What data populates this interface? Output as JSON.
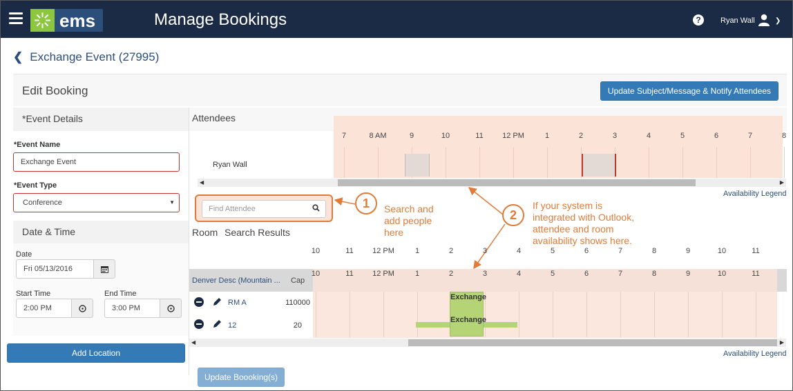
{
  "header": {
    "app_name": "ems",
    "page_title": "Manage Bookings",
    "user_name": "Ryan Wall",
    "colors": {
      "topbar": "#1c2b45",
      "brand_green": "#8dc63f",
      "primary": "#337ab7",
      "accent": "#e07b39"
    }
  },
  "event": {
    "title": "Exchange Event (27995)"
  },
  "edit_booking": {
    "title": "Edit Booking",
    "update_notify_label": "Update Subject/Message & Notify Attendees"
  },
  "event_details": {
    "section_title": "*Event Details",
    "event_name_label": "*Event Name",
    "event_name_value": "Exchange Event",
    "event_type_label": "*Event Type",
    "event_type_value": "Conference"
  },
  "date_time": {
    "section_title": "Date & Time",
    "date_label": "Date",
    "date_value": "Fri 05/13/2016",
    "start_label": "Start Time",
    "start_value": "2:00 PM",
    "end_label": "End Time",
    "end_value": "3:00 PM"
  },
  "add_location_label": "Add Location",
  "attendees": {
    "title": "Attendees",
    "hours": [
      "7",
      "8 AM",
      "9",
      "10",
      "11",
      "12 PM",
      "1",
      "2",
      "3",
      "4",
      "5",
      "6",
      "7",
      "8"
    ],
    "rows": [
      {
        "name": "Ryan Wall"
      }
    ],
    "availability_legend": "Availability Legend",
    "find_placeholder": "Find Attendee"
  },
  "callouts": [
    {
      "number": "1",
      "lines": [
        "Search and",
        "add people",
        "here"
      ]
    },
    {
      "number": "2",
      "lines": [
        "If your system is",
        "integrated with Outlook,",
        "attendee and room",
        "availability shows here."
      ]
    }
  ],
  "rooms": {
    "tabs": [
      "Room",
      "Search Results"
    ],
    "hours": [
      "10",
      "11",
      "12 PM",
      "1",
      "2",
      "3",
      "4",
      "5",
      "6",
      "7",
      "8",
      "9",
      "10",
      "11"
    ],
    "header_building": "Denver Desc (Mountain ...",
    "header_cap": "Cap",
    "rows": [
      {
        "name": "RM A",
        "cap": "110000",
        "booking": "Exchange"
      },
      {
        "name": "12",
        "cap": "20",
        "booking": "Exchange"
      }
    ],
    "availability_legend": "Availability Legend"
  },
  "update_bookings_label": "Update Boooking(s)"
}
